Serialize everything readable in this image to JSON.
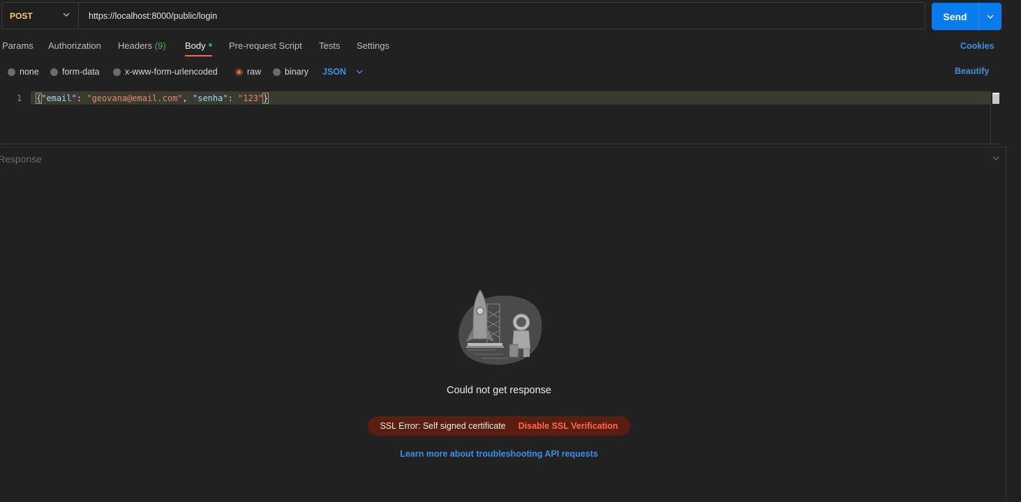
{
  "request": {
    "method": "POST",
    "url": "https://localhost:8000/public/login",
    "send_label": "Send"
  },
  "tabs": {
    "params": "Params",
    "authorization": "Authorization",
    "headers": "Headers",
    "headers_count": "(9)",
    "body": "Body",
    "pre_request": "Pre-request Script",
    "tests": "Tests",
    "settings": "Settings",
    "cookies": "Cookies",
    "active": "Body"
  },
  "body_types": {
    "none": "none",
    "form_data": "form-data",
    "urlencoded": "x-www-form-urlencoded",
    "raw": "raw",
    "binary": "binary",
    "selected": "raw",
    "format": "JSON",
    "beautify": "Beautify"
  },
  "editor": {
    "line_number": "1",
    "open_brace": "{",
    "key1": "\"email\"",
    "sep1": ": ",
    "val1": "\"geovana@email.com\"",
    "comma": ", ",
    "key2": "\"senha\"",
    "sep2": ": ",
    "val2": "\"123\"",
    "close_brace": "}"
  },
  "response": {
    "label": "Response",
    "message": "Could not get response",
    "ssl_error": "SSL Error: Self signed certificate",
    "ssl_action": "Disable SSL Verification",
    "learn_more": "Learn more about troubleshooting API requests"
  },
  "colors": {
    "accent_orange": "#ff6c37",
    "send_blue": "#097bed",
    "method_yellow": "#f8d055",
    "link_blue": "#3f8fe8",
    "error_bg": "#5a1d0f"
  }
}
